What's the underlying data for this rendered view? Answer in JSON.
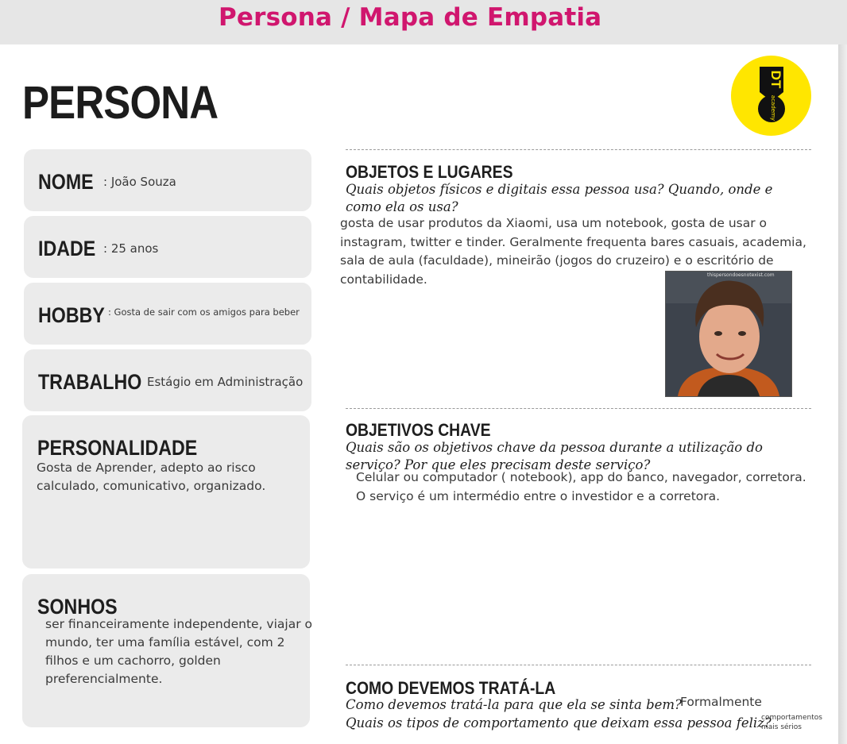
{
  "header": {
    "title": "Persona / Mapa de Empatia"
  },
  "page_title": "PERSONA",
  "logo": {
    "text_top": "DT",
    "text_bottom": "academy",
    "bg_color": "#ffe600"
  },
  "cards": {
    "nome": {
      "label": "NOME",
      "value": ": João Souza"
    },
    "idade": {
      "label": "IDADE",
      "value": ": 25  anos"
    },
    "hobby": {
      "label": "HOBBY",
      "value": ": Gosta de sair com os amigos para beber"
    },
    "trabalho": {
      "label": "TRABALHO",
      "value": "Estágio em Administração"
    },
    "personalidade": {
      "label": "PERSONALIDADE",
      "value": "Gosta de Aprender, adepto ao risco calculado, comunicativo, organizado."
    },
    "sonhos": {
      "label": "SONHOS",
      "value": "ser financeiramente independente, viajar o mundo, ter uma família estável, com 2 filhos e um cachorro, golden preferencialmente."
    }
  },
  "sections": {
    "objetos": {
      "title": "OBJETOS E LUGARES",
      "question": "Quais objetos físicos e digitais essa pessoa usa? Quando, onde e como ela os usa?",
      "answer": "gosta de usar produtos da Xiaomi, usa um notebook, gosta de usar o instagram, twitter e tinder. Geralmente frequenta bares casuais, academia, sala de aula (faculdade), mineirão (jogos do cruzeiro) e o escritório de contabilidade."
    },
    "objetivos": {
      "title": "OBJETIVOS CHAVE",
      "question": "Quais são os objetivos chave da pessoa durante a utilização do serviço? Por que eles precisam deste serviço?",
      "answer": "Celular ou computador ( notebook), app do banco, navegador, corretora. O serviço é um intermédio entre o investidor e a corretora."
    },
    "tratar": {
      "title": "COMO DEVEMOS TRATÁ-LA",
      "question_line1": "Como devemos tratá-la para que ela se sinta bem?",
      "question_line2": "Quais os tipos de comportamento que deixam essa pessoa feliz?",
      "answer": "Formalmente",
      "note": "comportamentos mais sérios"
    }
  },
  "photo": {
    "watermark": "thispersondoesnotexist.com"
  },
  "colors": {
    "accent": "#d0166e",
    "card_bg": "#ebebeb",
    "logo_yellow": "#ffe600"
  }
}
